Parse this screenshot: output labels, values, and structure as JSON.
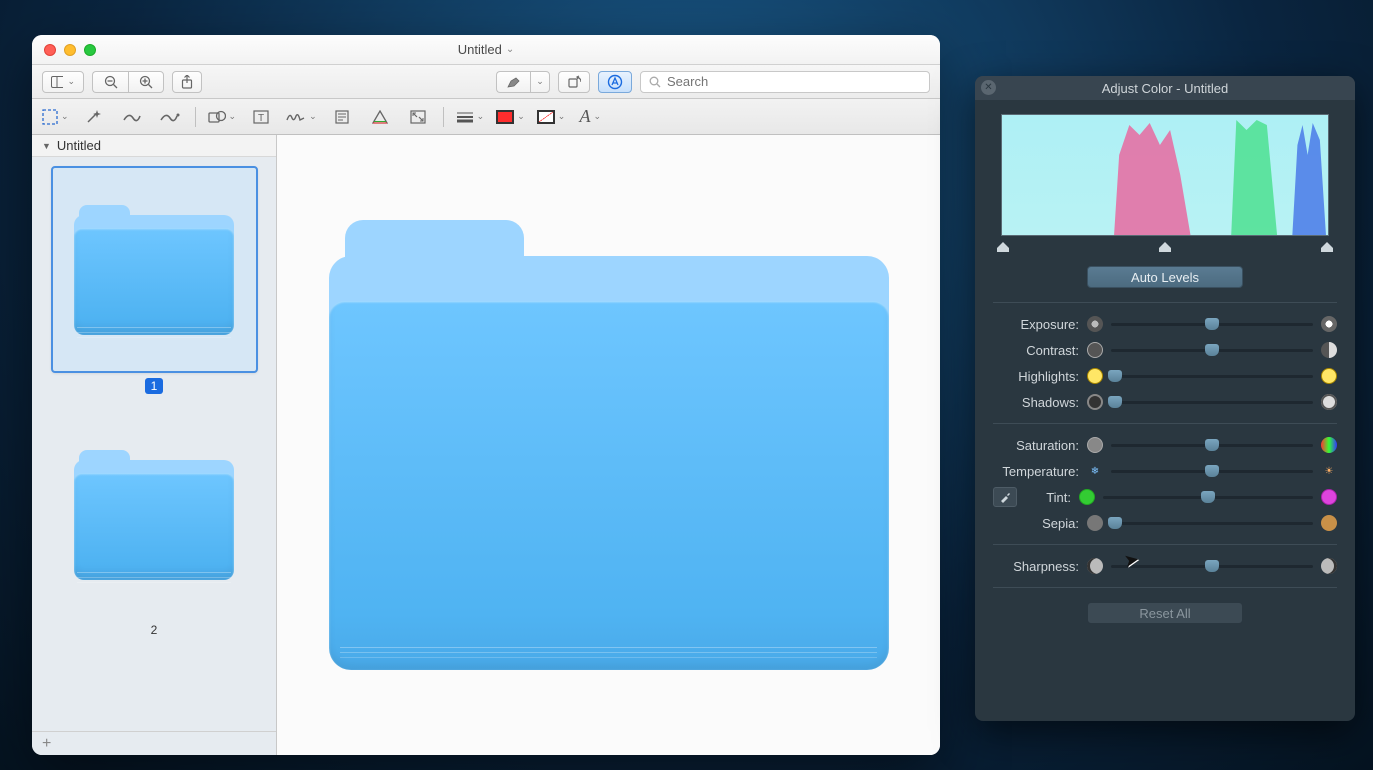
{
  "preview": {
    "title": "Untitled",
    "search_placeholder": "Search",
    "sidebar_title": "Untitled",
    "thumbs": [
      {
        "label": "1",
        "selected": true
      },
      {
        "label": "2",
        "selected": false
      }
    ],
    "toolbar1": {
      "sidebar": "sidebar",
      "zoom_out": "zoom-out",
      "zoom_in": "zoom-in",
      "share": "share",
      "markup": "markup",
      "rotate": "rotate",
      "edit": "edit"
    },
    "toolbar2": {
      "select": "rectangular-selection",
      "instant_alpha": "instant-alpha",
      "lasso": "lasso",
      "smart_lasso": "smart-lasso",
      "shapes": "shapes",
      "text": "text",
      "sign": "sign",
      "note": "note",
      "adjust_color": "adjust-color",
      "adjust_size": "adjust-size",
      "line_style": "line-style",
      "border_color": "border-color",
      "fill_color": "fill-color",
      "font": "font"
    }
  },
  "adjust": {
    "title": "Adjust Color - Untitled",
    "auto_levels": "Auto Levels",
    "reset_all": "Reset All",
    "sliders": {
      "exposure": {
        "label": "Exposure:",
        "pos": 50
      },
      "contrast": {
        "label": "Contrast:",
        "pos": 50
      },
      "highlights": {
        "label": "Highlights:",
        "pos": 2
      },
      "shadows": {
        "label": "Shadows:",
        "pos": 2
      },
      "saturation": {
        "label": "Saturation:",
        "pos": 50
      },
      "temperature": {
        "label": "Temperature:",
        "pos": 50
      },
      "tint": {
        "label": "Tint:",
        "pos": 50
      },
      "sepia": {
        "label": "Sepia:",
        "pos": 2
      },
      "sharpness": {
        "label": "Sharpness:",
        "pos": 50
      }
    }
  }
}
